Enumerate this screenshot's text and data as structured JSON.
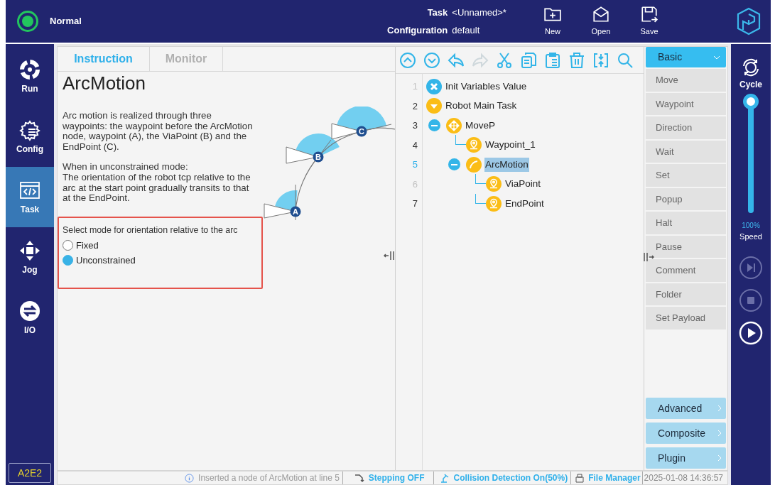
{
  "header": {
    "status": {
      "label": "Normal",
      "color": "#22c55e"
    },
    "task_label": "Task",
    "task_value": "<Unnamed>*",
    "config_label": "Configuration",
    "config_value": "default",
    "actions": [
      {
        "kind": "new",
        "label": "New"
      },
      {
        "kind": "open",
        "label": "Open"
      },
      {
        "kind": "save",
        "label": "Save"
      }
    ]
  },
  "sidebar": {
    "items": [
      {
        "kind": "run",
        "label": "Run",
        "selected": false
      },
      {
        "kind": "config",
        "label": "Config",
        "selected": false
      },
      {
        "kind": "task",
        "label": "Task",
        "selected": true
      },
      {
        "kind": "jog",
        "label": "Jog",
        "selected": false
      },
      {
        "kind": "io",
        "label": "I/O",
        "selected": false
      }
    ],
    "badge": "A2E2"
  },
  "instruction": {
    "tabs": [
      {
        "label": "Instruction",
        "selected": true
      },
      {
        "label": "Monitor",
        "selected": false
      }
    ],
    "title": "ArcMotion",
    "paragraphs": [
      "Arc motion is realized through three waypoints: the waypoint before the ArcMotion node, waypoint (A), the ViaPoint (B) and the EndPoint (C).",
      "When in unconstrained mode:\nThe orientation of the robot tcp relative to the arc at the start point gradually transits to that at the EndPoint."
    ],
    "diagram_labels": [
      "A",
      "B",
      "C"
    ],
    "option_label": "Select mode for orientation relative to the arc",
    "options": [
      {
        "label": "Fixed",
        "selected": false
      },
      {
        "label": "Unconstrained",
        "selected": true
      }
    ]
  },
  "toolbar": [
    {
      "kind": "up",
      "disabled": false
    },
    {
      "kind": "down",
      "disabled": false
    },
    {
      "kind": "undo",
      "disabled": false
    },
    {
      "kind": "redo",
      "disabled": true
    },
    {
      "kind": "cut",
      "disabled": false
    },
    {
      "kind": "copy",
      "disabled": false
    },
    {
      "kind": "paste",
      "disabled": false
    },
    {
      "kind": "delete",
      "disabled": false
    },
    {
      "kind": "fold",
      "disabled": false
    },
    {
      "kind": "search",
      "disabled": false
    }
  ],
  "tree": [
    {
      "line": "1",
      "label": "Init Variables Value",
      "kind": "init",
      "dimmed": true,
      "selected": false
    },
    {
      "line": "2",
      "label": "Robot Main Task",
      "kind": "main",
      "dimmed": false,
      "selected": false,
      "children": [
        {
          "line": "3",
          "label": "MoveP",
          "kind": "move",
          "dimmed": false,
          "selected": false,
          "expanded": true,
          "children": [
            {
              "line": "4",
              "label": "Waypoint_1",
              "kind": "waypoint",
              "dimmed": false,
              "selected": false
            },
            {
              "line": "5",
              "label": "ArcMotion",
              "kind": "arc",
              "dimmed": false,
              "selected": true,
              "expanded": true,
              "children": [
                {
                  "line": "6",
                  "label": "ViaPoint",
                  "kind": "waypoint",
                  "dimmed": true,
                  "selected": false
                },
                {
                  "line": "7",
                  "label": "EndPoint",
                  "kind": "waypoint",
                  "dimmed": false,
                  "selected": false
                }
              ]
            }
          ]
        }
      ]
    }
  ],
  "palette": {
    "group": "Basic",
    "items": [
      "Move",
      "Waypoint",
      "Direction",
      "Wait",
      "Set",
      "Popup",
      "Halt",
      "Pause",
      "Comment",
      "Folder",
      "Set Payload"
    ],
    "more": [
      "Advanced",
      "Composite",
      "Plugin"
    ]
  },
  "run_panel": {
    "cycle": "Cycle",
    "speed": {
      "level": 1,
      "reading": "100%",
      "label": "Speed"
    },
    "controls": [
      {
        "kind": "step",
        "disabled": true
      },
      {
        "kind": "stop",
        "disabled": true
      },
      {
        "kind": "play",
        "disabled": false
      }
    ]
  },
  "status_bar": {
    "message": "Inserted a node of  ArcMotion at line 5",
    "stepping": "Stepping OFF",
    "collision": "Collision Detection On(50%)",
    "files": "File Manager",
    "time": "2025-01-08 14:36:57"
  }
}
